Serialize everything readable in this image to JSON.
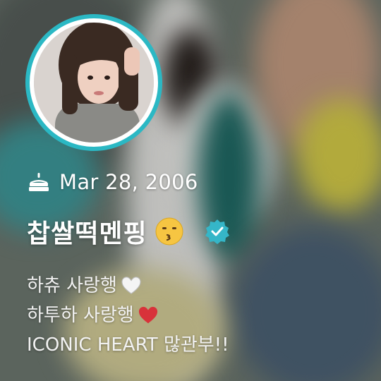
{
  "profile": {
    "birthday": "Mar 28, 2006",
    "name": "찹쌀떡멘핑",
    "name_emoji": "kissing-face-emoji",
    "verified_icon": "verified-badge-icon",
    "birthday_icon": "cake-icon",
    "accent_ring_color": "#2bb8c4",
    "verified_color": "#35b6c8"
  },
  "bio": {
    "lines": [
      {
        "text": "하츄 사랑행",
        "emoji": "white-heart-emoji"
      },
      {
        "text": "하투하 사랑행",
        "emoji": "red-heart-emoji"
      },
      {
        "text": "ICONIC HEART 많관부!!",
        "emoji": ""
      }
    ]
  }
}
